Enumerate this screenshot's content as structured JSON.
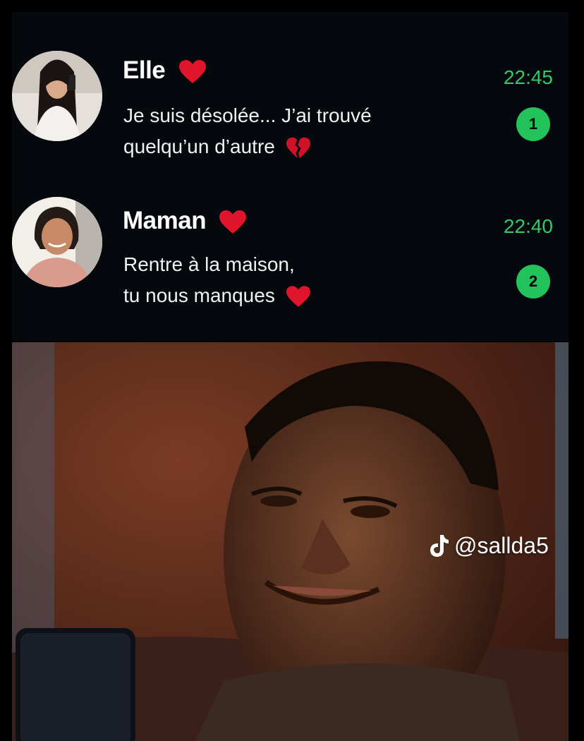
{
  "conversations": [
    {
      "name": "Elle",
      "name_icon": "red-heart",
      "message_line1": "Je suis désolée... J’ai trouvé",
      "message_line2": "quelqu’un d’autre",
      "message_icon": "broken-heart",
      "time": "22:45",
      "unread": "1"
    },
    {
      "name": "Maman",
      "name_icon": "red-heart",
      "message_line1": "Rentre à la maison,",
      "message_line2": "tu nous manques",
      "message_icon": "red-heart",
      "time": "22:40",
      "unread": "2"
    }
  ],
  "watermark": {
    "icon": "tiktok-note",
    "handle": "@sallda5"
  },
  "colors": {
    "accent": "#34c86a",
    "badge": "#22c35a",
    "background": "#05080c",
    "heart": "#e0142a"
  }
}
